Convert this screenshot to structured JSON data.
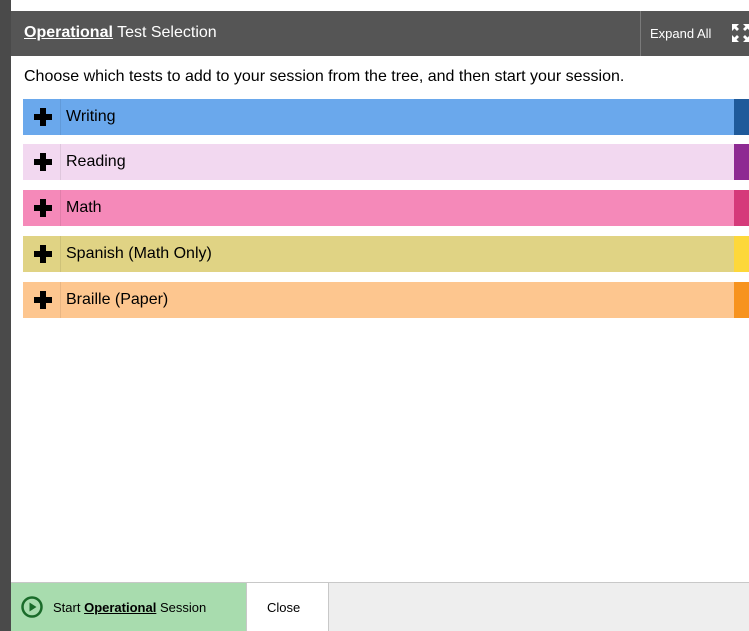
{
  "header": {
    "title_bold": "Operational",
    "title_rest": " Test Selection",
    "expand_all_label": "Expand All"
  },
  "instructions": "Choose which tests to add to your session from the tree, and then start your session.",
  "tree": {
    "items": [
      {
        "label": "Writing",
        "color": "#6aa8ec",
        "accent": "#1f5a9a",
        "icon": "plus-icon"
      },
      {
        "label": "Reading",
        "color": "#f2d8f0",
        "accent": "#8e2a92",
        "icon": "plus-icon"
      },
      {
        "label": "Math",
        "color": "#f589b9",
        "accent": "#d53a7a",
        "icon": "plus-icon"
      },
      {
        "label": "Spanish (Math Only)",
        "color": "#e0d384",
        "accent": "#fdd83a",
        "icon": "plus-icon"
      },
      {
        "label": "Braille (Paper)",
        "color": "#fdc68f",
        "accent": "#f7931e",
        "icon": "plus-icon"
      }
    ]
  },
  "footer": {
    "start_prefix": "Start ",
    "start_bold": "Operational",
    "start_suffix": " Session",
    "start_icon": "play-circle-icon",
    "close_label": "Close"
  }
}
